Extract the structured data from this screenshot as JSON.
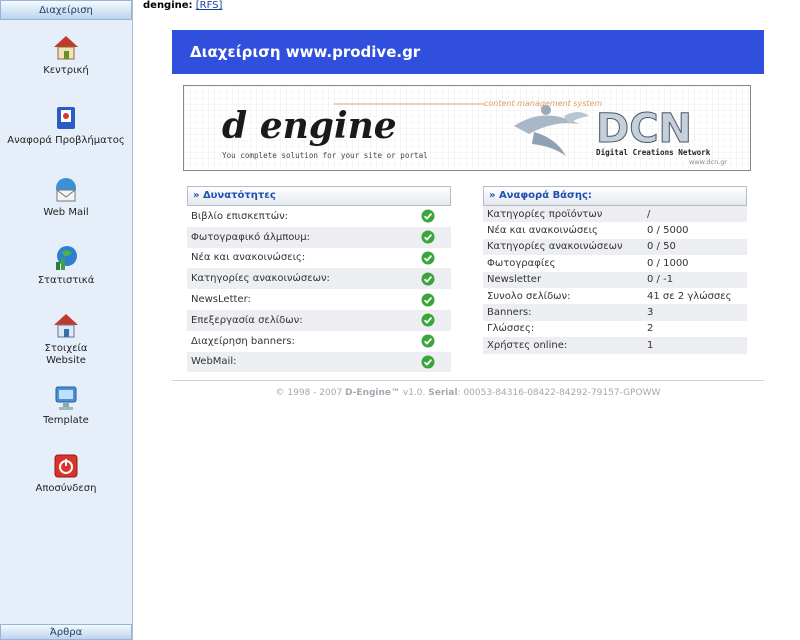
{
  "sidebar": {
    "header": "Διαχείριση",
    "footer": "Άρθρα",
    "items": [
      {
        "label": "Κεντρική",
        "icon": "home-icon"
      },
      {
        "label": "Αναφορά Προβλήματος",
        "icon": "bug-report-icon"
      },
      {
        "label": "Web Mail",
        "icon": "webmail-icon"
      },
      {
        "label": "Στατιστικά",
        "icon": "statistics-icon"
      },
      {
        "label": "Στοιχεία Website",
        "icon": "website-info-icon"
      },
      {
        "label": "Template",
        "icon": "template-icon"
      },
      {
        "label": "Αποσύνδεση",
        "icon": "logout-icon"
      }
    ]
  },
  "topbar": {
    "prefix": "dengine:",
    "link": "[RFS]"
  },
  "header": {
    "title": "Διαχείριση www.prodive.gr"
  },
  "banner": {
    "logo_text": "d engine",
    "tag_top": "content management system",
    "tag_bottom": "You complete solution for your site or portal",
    "dcn_text": "DCN",
    "dcn_subtitle": "Digital Creations Network",
    "dcn_url": "www.dcn.gr"
  },
  "capabilities": {
    "title": "» Δυνατότητες",
    "items": [
      "Βιβλίο επισκεπτών:",
      "Φωτογραφικό άλμπουμ:",
      "Νέα και ανακοινώσεις:",
      "Κατηγορίες ανακοινώσεων:",
      "NewsLetter:",
      "Επεξεργασία σελίδων:",
      "Διαχείρηση banners:",
      "WebMail:"
    ]
  },
  "report": {
    "title": "» Αναφορά Βάσης:",
    "rows": [
      {
        "label": "Κατηγορίες προϊόντων",
        "value": "/"
      },
      {
        "label": "Νέα και ανακοινώσεις",
        "value": "0 / 5000"
      },
      {
        "label": "Κατηγορίες ανακοινώσεων",
        "value": "0 / 50"
      },
      {
        "label": "Φωτογραφίες",
        "value": "0 / 1000"
      },
      {
        "label": "Newsletter",
        "value": "0 / -1"
      },
      {
        "label": "Συνολο σελίδων:",
        "value": "41 σε 2 γλώσσες"
      },
      {
        "label": "Banners:",
        "value": "3"
      },
      {
        "label": "Γλώσσες:",
        "value": "2"
      },
      {
        "label": "Χρήστες online:",
        "value": "1"
      }
    ]
  },
  "footer": {
    "copyright": "© 1998 - 2007",
    "product": "D-Engine™",
    "version": "v1.0.",
    "serial_label": "Serial",
    "serial": ": 00053-84316-08422-84292-79157-GPOWW"
  },
  "colors": {
    "header_bg": "#2f4fdc",
    "check": "#3aa53a",
    "panel_title": "#1f4fb1"
  }
}
